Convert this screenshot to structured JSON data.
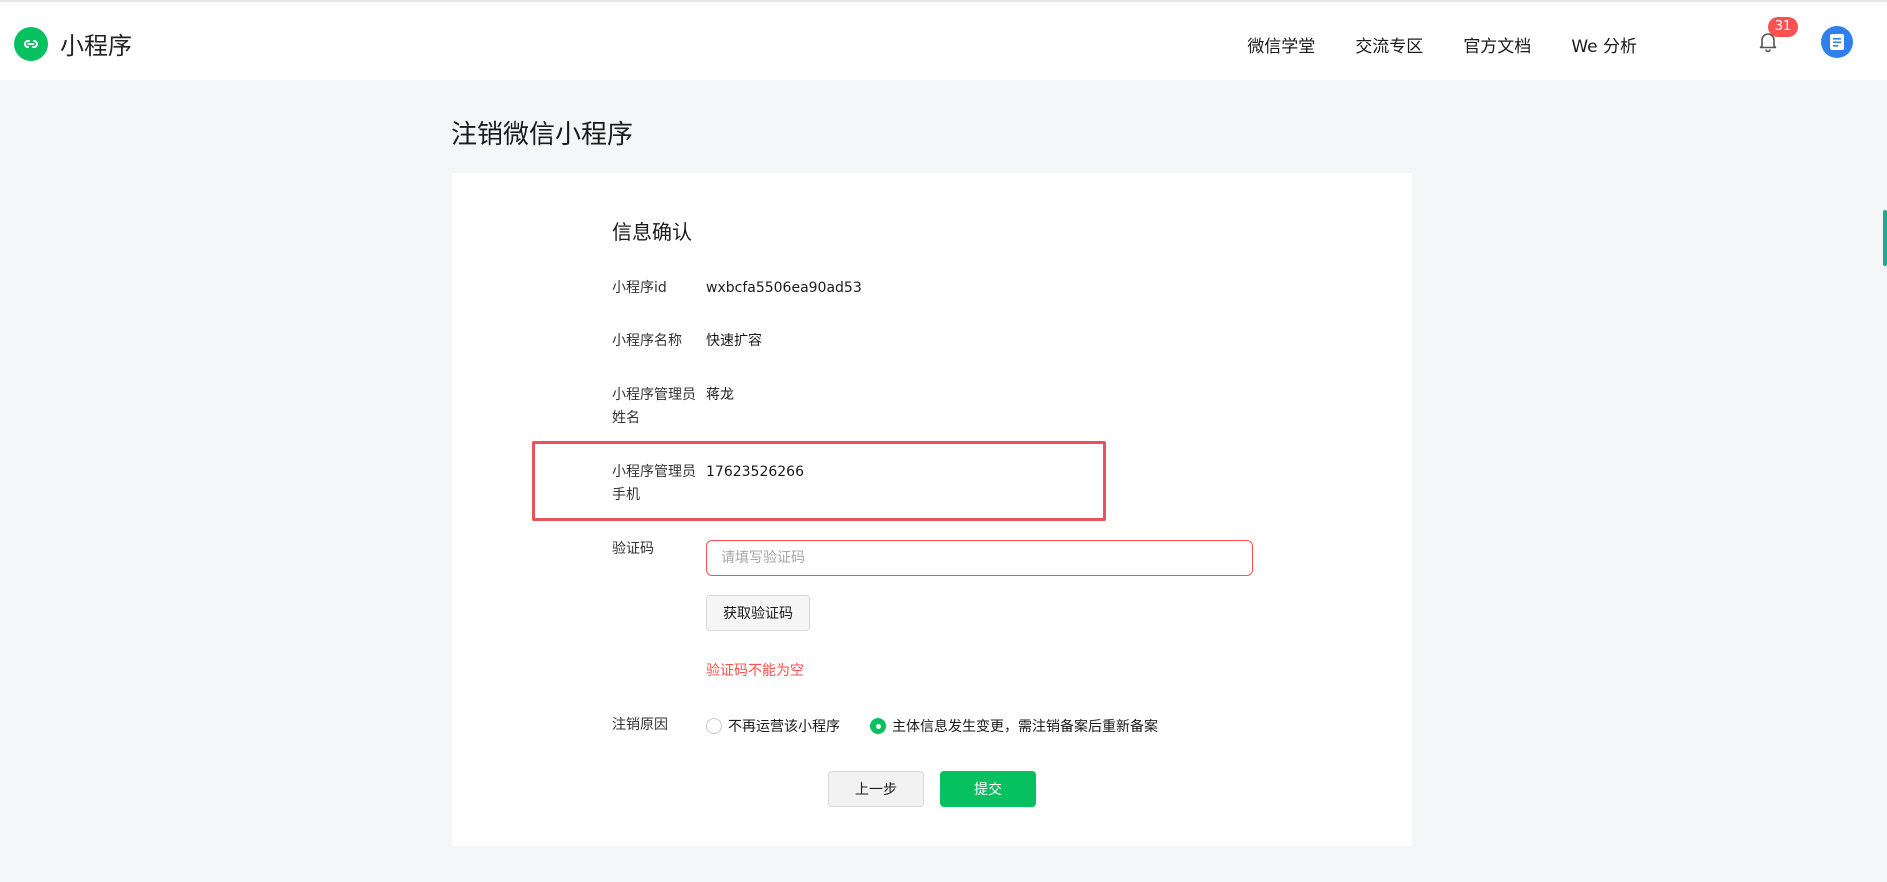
{
  "app": {
    "name": "小程序",
    "logo_icon": "miniprogram-link-icon",
    "brand_color": "#07c160"
  },
  "nav": {
    "items": [
      {
        "label": "微信学堂"
      },
      {
        "label": "交流专区"
      },
      {
        "label": "官方文档"
      },
      {
        "label": "We 分析"
      }
    ],
    "notifications_count": "31",
    "bell_icon": "bell-icon",
    "avatar_icon": "document-avatar-icon"
  },
  "page": {
    "title": "注销微信小程序"
  },
  "form": {
    "section_title": "信息确认",
    "rows": [
      {
        "label": "小程序id",
        "value": "wxbcfa5506ea90ad53"
      },
      {
        "label": "小程序名称",
        "value": "快速扩容"
      },
      {
        "label": "小程序管理员姓名",
        "value": "蒋龙"
      },
      {
        "label": "小程序管理员手机",
        "value": "17623526266"
      }
    ],
    "code": {
      "label": "验证码",
      "placeholder": "请填写验证码",
      "value": "",
      "get_code_label": "获取验证码",
      "error": "验证码不能为空"
    },
    "reason": {
      "label": "注销原因",
      "options": [
        {
          "label": "不再运营该小程序",
          "checked": false
        },
        {
          "label": "主体信息发生变更，需注销备案后重新备案",
          "checked": true
        }
      ]
    },
    "actions": {
      "prev_label": "上一步",
      "submit_label": "提交"
    }
  },
  "colors": {
    "accent": "#07c160",
    "error": "#fa5151",
    "highlight": "#e5545c",
    "badge": "#fa5151"
  }
}
